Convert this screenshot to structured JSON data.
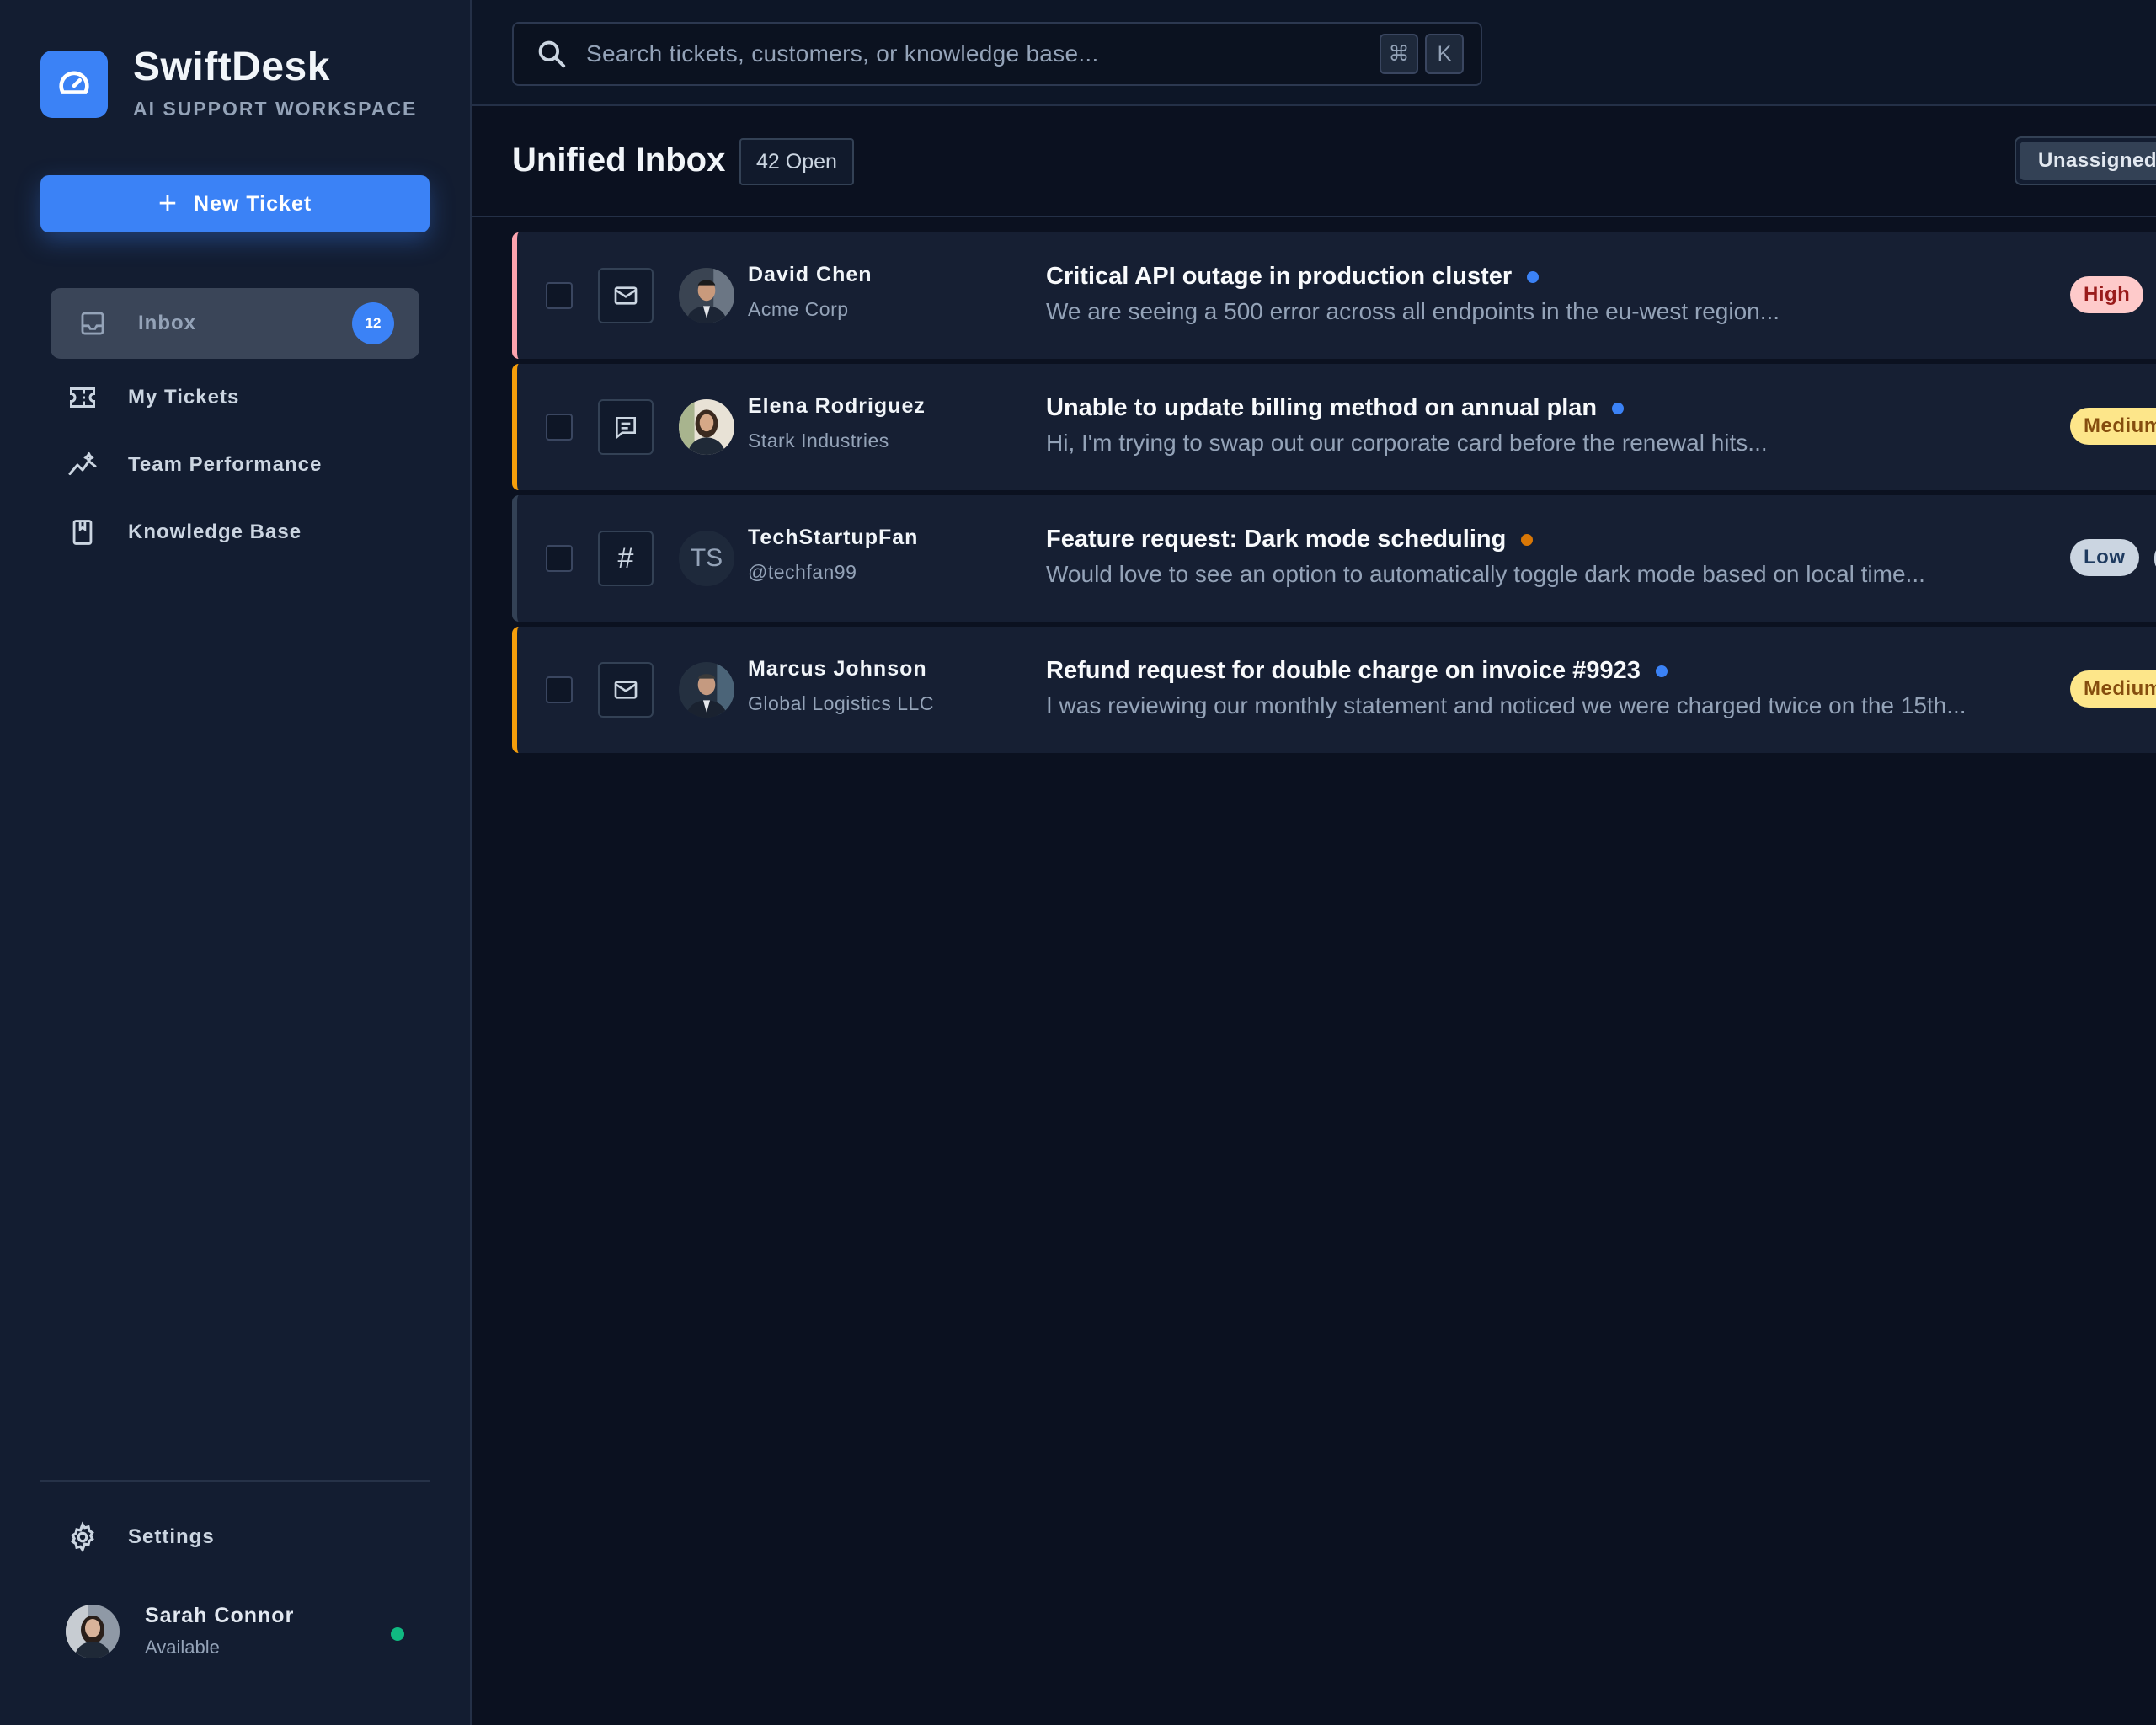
{
  "brand": {
    "name": "SwiftDesk",
    "subtitle": "AI SUPPORT WORKSPACE",
    "logo_icon": "speedometer-icon"
  },
  "sidebar": {
    "new_ticket_label": "New Ticket",
    "items": [
      {
        "label": "Inbox",
        "icon": "inbox-icon",
        "badge": "12",
        "active": true
      },
      {
        "label": "My Tickets",
        "icon": "ticket-icon"
      },
      {
        "label": "Team Performance",
        "icon": "trending-icon"
      },
      {
        "label": "Knowledge Base",
        "icon": "book-icon"
      }
    ],
    "settings_label": "Settings",
    "user": {
      "name": "Sarah Connor",
      "status": "Available"
    }
  },
  "search": {
    "placeholder": "Search tickets, customers, or knowledge base...",
    "shortcut_keys": [
      "⌘",
      "K"
    ]
  },
  "inbox": {
    "title": "Unified Inbox",
    "open_count": "42 Open",
    "filter_label": "Unassigned"
  },
  "tickets": [
    {
      "customer": "David Chen",
      "org": "Acme Corp",
      "channel": "mail-icon",
      "subject": "Critical API outage in production cluster",
      "preview": "We are seeing a 500 error across all endpoints in the eu-west region...",
      "priority": "High",
      "accent": "#fda4af",
      "dot_color": "#3b82f6"
    },
    {
      "customer": "Elena Rodriguez",
      "org": "Stark Industries",
      "channel": "chat-icon",
      "subject": "Unable to update billing method on annual plan",
      "preview": "Hi, I'm trying to swap out our corporate card before the renewal hits...",
      "priority": "Medium",
      "accent": "#f59e0b",
      "dot_color": "#3b82f6"
    },
    {
      "customer": "TechStartupFan",
      "org": "@techfan99",
      "initials": "TS",
      "channel": "hash-icon",
      "channel_glyph": "#",
      "subject": "Feature request: Dark mode scheduling",
      "preview": "Would love to see an option to automatically toggle dark mode based on local time...",
      "priority": "Low",
      "accent": "#334155",
      "dot_color": "#d97706"
    },
    {
      "customer": "Marcus Johnson",
      "org": "Global Logistics LLC",
      "channel": "mail-icon",
      "subject": "Refund request for double charge on invoice #9923",
      "preview": "I was reviewing our monthly statement and noticed we were charged twice on the 15th...",
      "priority": "Medium",
      "accent": "#f59e0b",
      "dot_color": "#3b82f6"
    }
  ]
}
